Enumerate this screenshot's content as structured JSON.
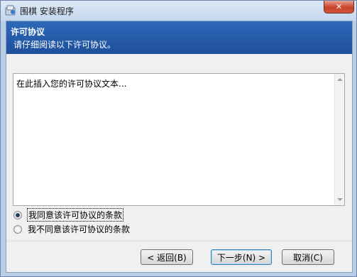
{
  "window": {
    "title": "围棋 安装程序",
    "close_label": "✕"
  },
  "banner": {
    "title": "许可协议",
    "subtitle": "请仔细阅读以下许可协议。"
  },
  "license": {
    "text": "在此插入您的许可协议文本..."
  },
  "options": [
    {
      "label": "我同意该许可协议的条款",
      "selected": true
    },
    {
      "label": "我不同意该许可协议的条款",
      "selected": false
    }
  ],
  "buttons": {
    "back": "< 返回(B)",
    "next": "下一步(N) >",
    "cancel": "取消(C)"
  }
}
